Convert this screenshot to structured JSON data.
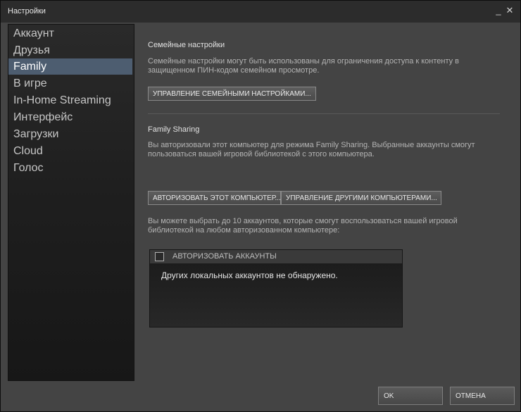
{
  "window": {
    "title": "Настройки",
    "minimize_glyph": "_",
    "close_glyph": "✕"
  },
  "sidebar": {
    "items": [
      {
        "label": "Аккаунт",
        "active": false
      },
      {
        "label": "Друзья",
        "active": false
      },
      {
        "label": "Family",
        "active": true
      },
      {
        "label": "В игре",
        "active": false
      },
      {
        "label": "In-Home Streaming",
        "active": false
      },
      {
        "label": "Интерфейс",
        "active": false
      },
      {
        "label": "Загрузки",
        "active": false
      },
      {
        "label": "Cloud",
        "active": false
      },
      {
        "label": "Голос",
        "active": false
      }
    ]
  },
  "family_settings": {
    "title": "Семейные настройки",
    "desc_line1": "Семейные настройки могут быть использованы для ограничения доступа к контенту в",
    "desc_line2": "защищенном ПИН-кодом семейном просмотре.",
    "manage_button": "УПРАВЛЕНИЕ СЕМЕЙНЫМИ НАСТРОЙКАМИ..."
  },
  "family_sharing": {
    "title": "Family Sharing",
    "desc_line1": "Вы авторизовали этот компьютер для режима Family Sharing. Выбранные аккаунты смогут",
    "desc_line2": "пользоваться вашей игровой библиотекой с этого компьютера.",
    "authorize_button": "АВТОРИЗОВАТЬ ЭТОТ КОМПЬЮТЕР...",
    "manage_others_button": "УПРАВЛЕНИЕ ДРУГИМИ КОМПЬЮТЕРАМИ...",
    "limit_line1": "Вы можете выбрать до 10 аккаунтов, которые смогут воспользоваться вашей игровой",
    "limit_line2": "библиотекой на любом авторизованном компьютере:",
    "accounts_header": "АВТОРИЗОВАТЬ АККАУНТЫ",
    "accounts_empty": "Других локальных аккаунтов не обнаружено."
  },
  "footer": {
    "ok": "OK",
    "cancel": "ОТМЕНА"
  }
}
